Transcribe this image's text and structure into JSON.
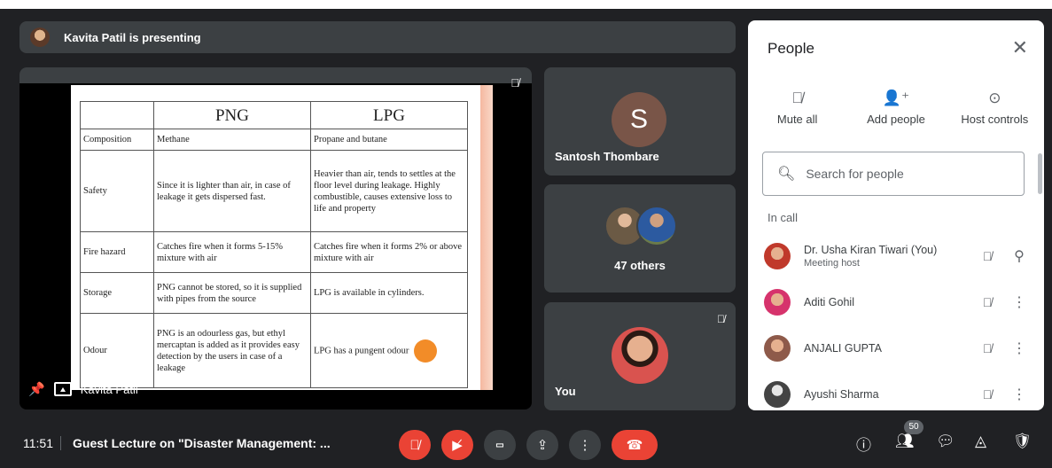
{
  "presenter_bar": {
    "text": "Kavita Patil is presenting"
  },
  "slide": {
    "headers": [
      "",
      "PNG",
      "LPG"
    ],
    "rows": [
      [
        "Composition",
        "Methane",
        "Propane and butane"
      ],
      [
        "Safety",
        "Since it is lighter than air, in case of leakage it gets dispersed fast.",
        "Heavier than air, tends to settles at the floor level during leakage. Highly combustible, causes extensive loss to life and property"
      ],
      [
        "Fire hazard",
        "Catches fire when it forms 5-15% mixture with air",
        "Catches fire when it forms 2% or above mixture with air"
      ],
      [
        "Storage",
        "PNG cannot be stored, so it is supplied with pipes from the source",
        "LPG is available in cylinders."
      ],
      [
        "Odour",
        "PNG is an odourless gas, but ethyl mercaptan is added as it provides easy detection by the users in case of a leakage",
        "LPG has a pungent odour"
      ]
    ]
  },
  "main_tile": {
    "name": "Kavita Patil"
  },
  "tiles": {
    "santosh": {
      "initial": "S",
      "name": "Santosh Thombare"
    },
    "others": {
      "label": "47 others"
    },
    "you": {
      "name": "You"
    }
  },
  "people_panel": {
    "title": "People",
    "close_label": "✕",
    "actions": [
      {
        "icon": "mic-off-icon",
        "label": "Mute all"
      },
      {
        "icon": "add-person-icon",
        "label": "Add people"
      },
      {
        "icon": "toggle-icon",
        "label": "Host controls"
      }
    ],
    "search_placeholder": "Search for people",
    "section_label": "In call",
    "participants": [
      {
        "name": "Dr. Usha Kiran Tiwari (You)",
        "subtitle": "Meeting host",
        "avatar_color": "#c0392b"
      },
      {
        "name": "Aditi Gohil",
        "subtitle": "",
        "avatar_color": "#d6336c"
      },
      {
        "name": "ANJALI GUPTA",
        "subtitle": "",
        "avatar_color": "#8e5a4a"
      },
      {
        "name": "Ayushi Sharma",
        "subtitle": "",
        "avatar_color": "#444444"
      }
    ]
  },
  "bottom_bar": {
    "time": "11:51",
    "meeting_title": "Guest Lecture on \"Disaster Management: ...",
    "participant_count": "50"
  },
  "colors": {
    "red": "#ea4335",
    "dark": "#202124",
    "tile": "#3c4043"
  }
}
